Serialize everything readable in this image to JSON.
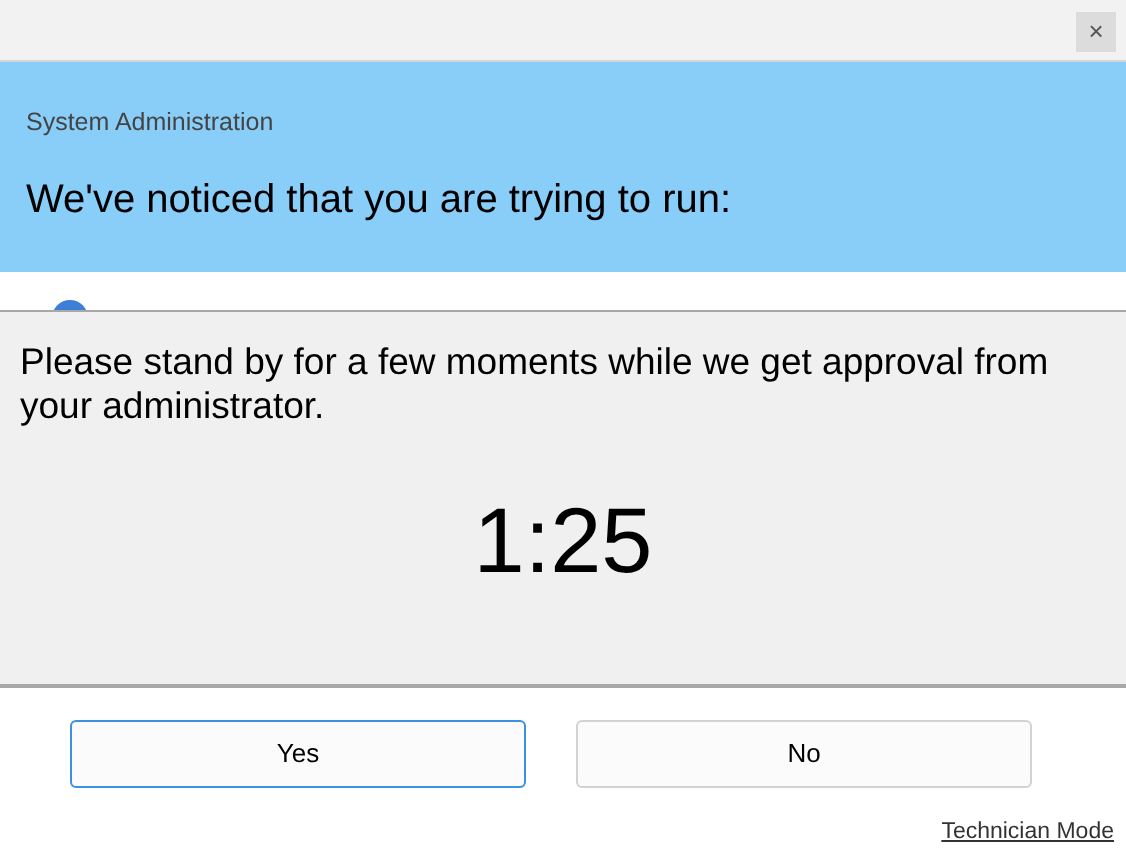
{
  "close_button": {
    "label": "×"
  },
  "header": {
    "subtitle": "System Administration",
    "title": "We've noticed that you are trying to run:"
  },
  "wait_panel": {
    "message": "Please stand by for a few moments while we get approval from your administrator.",
    "countdown": "1:25"
  },
  "buttons": [
    {
      "label": "Yes",
      "focused": true
    },
    {
      "label": "No",
      "focused": false
    }
  ],
  "footer_link": "Technician Mode"
}
